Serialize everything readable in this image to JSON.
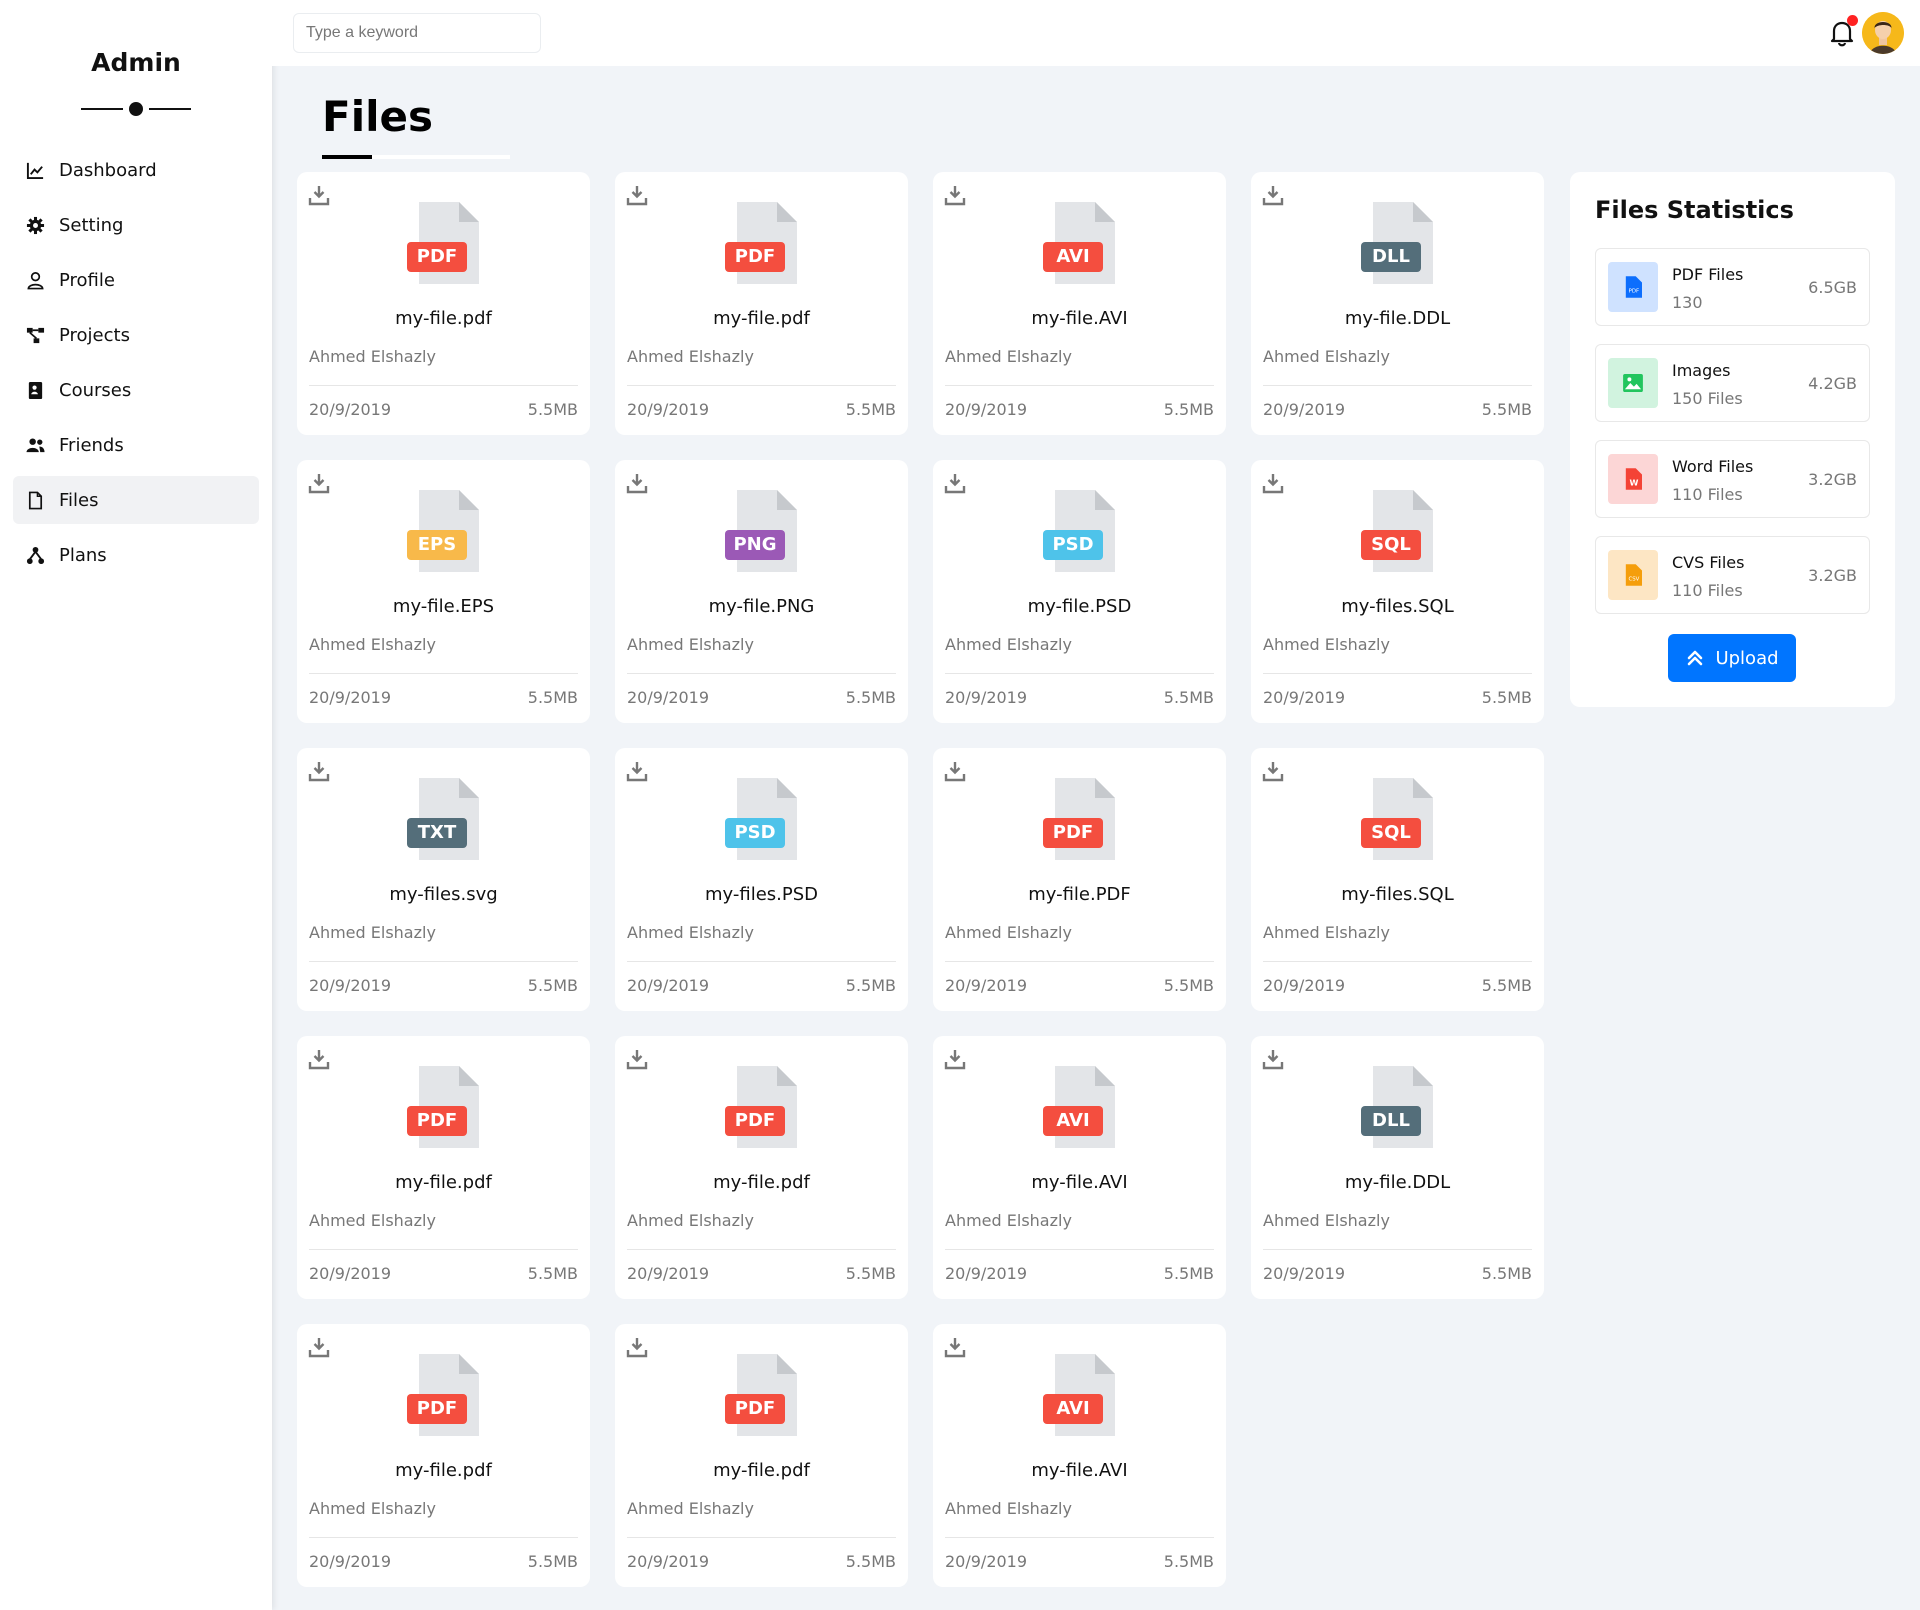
{
  "sidebar": {
    "title": "Admin",
    "items": [
      {
        "label": "Dashboard",
        "icon": "chart-line-icon",
        "active": false
      },
      {
        "label": "Setting",
        "icon": "gear-icon",
        "active": false
      },
      {
        "label": "Profile",
        "icon": "user-icon",
        "active": false
      },
      {
        "label": "Projects",
        "icon": "diagram-project-icon",
        "active": false
      },
      {
        "label": "Courses",
        "icon": "graduation-icon",
        "active": false
      },
      {
        "label": "Friends",
        "icon": "users-icon",
        "active": false
      },
      {
        "label": "Files",
        "icon": "file-icon",
        "active": true
      },
      {
        "label": "Plans",
        "icon": "diagram-icon",
        "active": false
      }
    ]
  },
  "topbar": {
    "search_placeholder": "Type a keyword",
    "notification_badge": "red-dot",
    "avatar": "user-avatar"
  },
  "page": {
    "title": "Files"
  },
  "colors": {
    "accent": "#0075ff",
    "PDF": "#f44e3f",
    "AVI": "#f44e3f",
    "SQL": "#f44e3f",
    "DLL": "#546e7a",
    "TXT": "#546e7a",
    "EPS": "#f8b94a",
    "PNG": "#9b59b6",
    "PSD": "#4ec3ea"
  },
  "files": [
    {
      "type": "PDF",
      "name": "my-file.pdf",
      "owner": "Ahmed Elshazly",
      "date": "20/9/2019",
      "size": "5.5MB"
    },
    {
      "type": "PDF",
      "name": "my-file.pdf",
      "owner": "Ahmed Elshazly",
      "date": "20/9/2019",
      "size": "5.5MB"
    },
    {
      "type": "AVI",
      "name": "my-file.AVI",
      "owner": "Ahmed Elshazly",
      "date": "20/9/2019",
      "size": "5.5MB"
    },
    {
      "type": "DLL",
      "name": "my-file.DDL",
      "owner": "Ahmed Elshazly",
      "date": "20/9/2019",
      "size": "5.5MB"
    },
    {
      "type": "EPS",
      "name": "my-file.EPS",
      "owner": "Ahmed Elshazly",
      "date": "20/9/2019",
      "size": "5.5MB"
    },
    {
      "type": "PNG",
      "name": "my-file.PNG",
      "owner": "Ahmed Elshazly",
      "date": "20/9/2019",
      "size": "5.5MB"
    },
    {
      "type": "PSD",
      "name": "my-file.PSD",
      "owner": "Ahmed Elshazly",
      "date": "20/9/2019",
      "size": "5.5MB"
    },
    {
      "type": "SQL",
      "name": "my-files.SQL",
      "owner": "Ahmed Elshazly",
      "date": "20/9/2019",
      "size": "5.5MB"
    },
    {
      "type": "TXT",
      "name": "my-files.svg",
      "owner": "Ahmed Elshazly",
      "date": "20/9/2019",
      "size": "5.5MB"
    },
    {
      "type": "PSD",
      "name": "my-files.PSD",
      "owner": "Ahmed Elshazly",
      "date": "20/9/2019",
      "size": "5.5MB"
    },
    {
      "type": "PDF",
      "name": "my-file.PDF",
      "owner": "Ahmed Elshazly",
      "date": "20/9/2019",
      "size": "5.5MB"
    },
    {
      "type": "SQL",
      "name": "my-files.SQL",
      "owner": "Ahmed Elshazly",
      "date": "20/9/2019",
      "size": "5.5MB"
    },
    {
      "type": "PDF",
      "name": "my-file.pdf",
      "owner": "Ahmed Elshazly",
      "date": "20/9/2019",
      "size": "5.5MB"
    },
    {
      "type": "PDF",
      "name": "my-file.pdf",
      "owner": "Ahmed Elshazly",
      "date": "20/9/2019",
      "size": "5.5MB"
    },
    {
      "type": "AVI",
      "name": "my-file.AVI",
      "owner": "Ahmed Elshazly",
      "date": "20/9/2019",
      "size": "5.5MB"
    },
    {
      "type": "DLL",
      "name": "my-file.DDL",
      "owner": "Ahmed Elshazly",
      "date": "20/9/2019",
      "size": "5.5MB"
    },
    {
      "type": "PDF",
      "name": "my-file.pdf",
      "owner": "Ahmed Elshazly",
      "date": "20/9/2019",
      "size": "5.5MB"
    },
    {
      "type": "PDF",
      "name": "my-file.pdf",
      "owner": "Ahmed Elshazly",
      "date": "20/9/2019",
      "size": "5.5MB"
    },
    {
      "type": "AVI",
      "name": "my-file.AVI",
      "owner": "Ahmed Elshazly",
      "date": "20/9/2019",
      "size": "5.5MB"
    }
  ],
  "stats": {
    "title": "Files Statistics",
    "items": [
      {
        "name": "PDF Files",
        "count": "130",
        "size": "6.5GB",
        "icon": "pdf-file-icon",
        "bg": "#cfe2ff",
        "fg": "#0d6efd"
      },
      {
        "name": "Images",
        "count": "150 Files",
        "size": "4.2GB",
        "icon": "image-icon",
        "bg": "#d1f3df",
        "fg": "#22c55e"
      },
      {
        "name": "Word Files",
        "count": "110 Files",
        "size": "3.2GB",
        "icon": "word-file-icon",
        "bg": "#fcd6d6",
        "fg": "#f44336"
      },
      {
        "name": "CVS Files",
        "count": "110 Files",
        "size": "3.2GB",
        "icon": "csv-file-icon",
        "bg": "#fde6c4",
        "fg": "#f59e0b"
      }
    ],
    "upload_label": "Upload"
  }
}
